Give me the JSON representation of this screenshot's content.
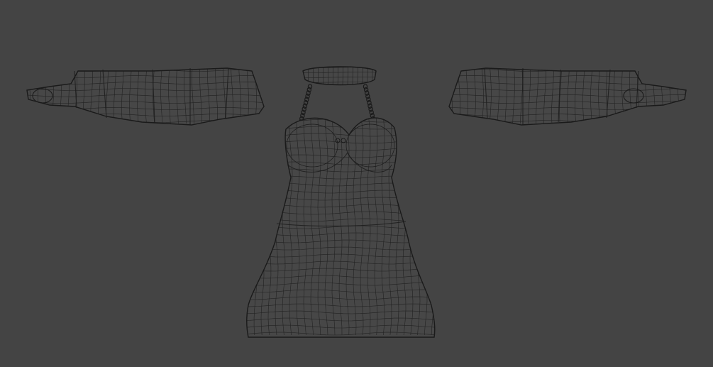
{
  "viewport": {
    "background_color": "#444444",
    "wire_color": "#1c1c1c",
    "surface_color": "#474747"
  },
  "model": {
    "parts": [
      {
        "name": "left-sleeve"
      },
      {
        "name": "right-sleeve"
      },
      {
        "name": "collar"
      },
      {
        "name": "straps"
      },
      {
        "name": "bodice"
      },
      {
        "name": "skirt"
      }
    ]
  }
}
